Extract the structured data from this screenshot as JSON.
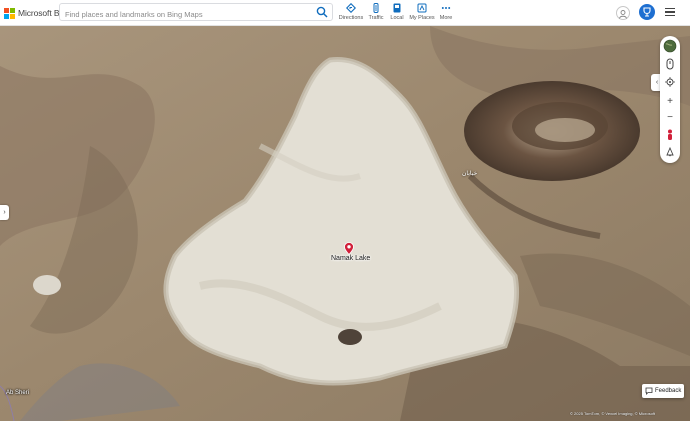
{
  "header": {
    "brand": "Microsoft Bing",
    "search_placeholder": "Find places and landmarks on Bing Maps",
    "nav": [
      {
        "label": "Directions",
        "icon": "directions-icon"
      },
      {
        "label": "Traffic",
        "icon": "traffic-icon"
      },
      {
        "label": "Local",
        "icon": "local-icon"
      },
      {
        "label": "My Places",
        "icon": "my-places-icon"
      },
      {
        "label": "More",
        "icon": "more-icon"
      }
    ]
  },
  "map": {
    "view": "aerial",
    "pin_label": "Namak Lake",
    "town_label": "Ab Sheri",
    "terrain_label": "خیابان",
    "attribution": "© 2025 TomTom, © Vexcel Imaging, © Microsoft",
    "feedback_label": "Feedback"
  },
  "controls": [
    "globe-icon",
    "compass-icon",
    "locate-icon",
    "zoom-in-icon",
    "zoom-out-icon",
    "street-view-icon",
    "bird-eye-icon"
  ],
  "colors": {
    "accent": "#0f6cbd",
    "pin": "#d1203a",
    "salt": "#e6e2d8",
    "desert": "#9b8a73"
  }
}
